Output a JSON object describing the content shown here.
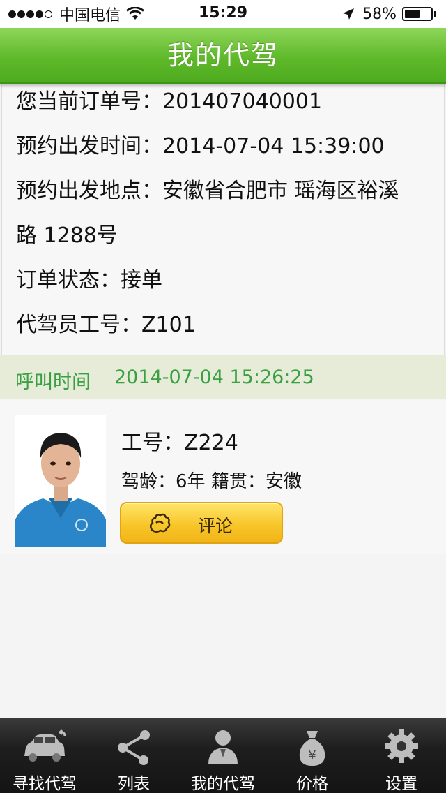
{
  "status_bar": {
    "carrier": "中国电信",
    "time": "15:29",
    "battery": "58%",
    "battery_level": 0.58
  },
  "header": {
    "title": "我的代驾"
  },
  "order": {
    "order_no_label": "您当前订单号：",
    "order_no": "201407040001",
    "depart_time_label": "预约出发时间：",
    "depart_time": "2014-07-04 15:39:00",
    "depart_place_label": "预约出发地点：",
    "depart_place_line1": "安徽省合肥市 瑶海区裕溪",
    "depart_place_line2": "路 1288号",
    "status_label": "订单状态：",
    "status": "接单",
    "driver_no_label": "代驾员工号：",
    "driver_no": "Z101"
  },
  "call": {
    "label": "呼叫时间",
    "time": "2014-07-04 15:26:25"
  },
  "driver": {
    "id_label": "工号：",
    "id": "Z224",
    "age_label": "驾龄：",
    "age": "6年",
    "origin_label": "籍贯：",
    "origin": "安徽",
    "comment_button": "评论",
    "comment_icon": "hands-icon"
  },
  "tabs": [
    {
      "label": "寻找代驾",
      "icon": "car-icon"
    },
    {
      "label": "列表",
      "icon": "share-nodes-icon"
    },
    {
      "label": "我的代驾",
      "icon": "person-icon"
    },
    {
      "label": "价格",
      "icon": "money-bag-icon"
    },
    {
      "label": "设置",
      "icon": "gear-icon"
    }
  ],
  "colors": {
    "header_green": "#5fb92a",
    "call_text_green": "#3aa043",
    "button_yellow": "#f8c62a"
  }
}
